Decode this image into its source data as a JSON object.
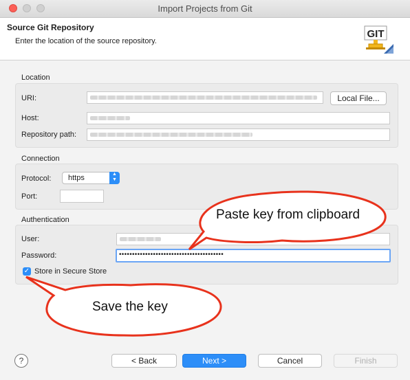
{
  "window": {
    "title": "Import Projects from Git"
  },
  "banner": {
    "title": "Source Git Repository",
    "description": "Enter the location of the source repository.",
    "icon_text": "GIT"
  },
  "location": {
    "group_label": "Location",
    "uri_label": "URI:",
    "host_label": "Host:",
    "repo_path_label": "Repository path:",
    "local_file_button": "Local File..."
  },
  "connection": {
    "group_label": "Connection",
    "protocol_label": "Protocol:",
    "protocol_value": "https",
    "port_label": "Port:"
  },
  "authentication": {
    "group_label": "Authentication",
    "user_label": "User:",
    "password_label": "Password:",
    "password_value": "••••••••••••••••••••••••••••••••••••••••",
    "store_label": "Store in Secure Store",
    "store_checked": true
  },
  "callouts": {
    "paste": "Paste key from clipboard",
    "save": "Save the key"
  },
  "footer": {
    "help_symbol": "?",
    "back_button": "< Back",
    "next_button": "Next >",
    "cancel_button": "Cancel",
    "finish_button": "Finish"
  },
  "colors": {
    "accent": "#2d8ef8",
    "callout_border": "#e8321c"
  }
}
